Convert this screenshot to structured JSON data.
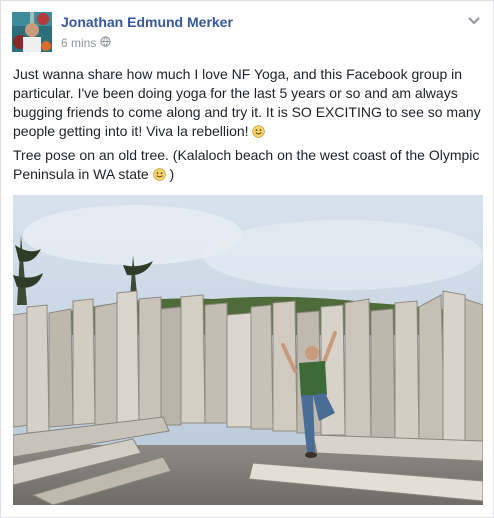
{
  "post": {
    "author": "Jonathan Edmund Merker",
    "time": "6 mins",
    "paragraph1": "Just wanna share how much I love NF Yoga, and this Facebook group in particular. I've been doing yoga for the last 5 years or so and am always bugging friends to come along and try it. It is SO EXCITING to see so many people getting into it! Viva la rebellion!",
    "paragraph2": "Tree pose on an old tree. (Kalaloch beach on the west coast of the Olympic Peninsula in WA state",
    "paragraph2_close": ")"
  },
  "icons": {
    "menu": "chevron-down-icon",
    "privacy": "globe-icon",
    "emoji": "smile-emoji-icon"
  },
  "colors": {
    "author": "#365899",
    "meta": "#90949c",
    "text": "#1d2129",
    "sky": "#c9d6e4",
    "driftwood": "#cfcac2"
  }
}
